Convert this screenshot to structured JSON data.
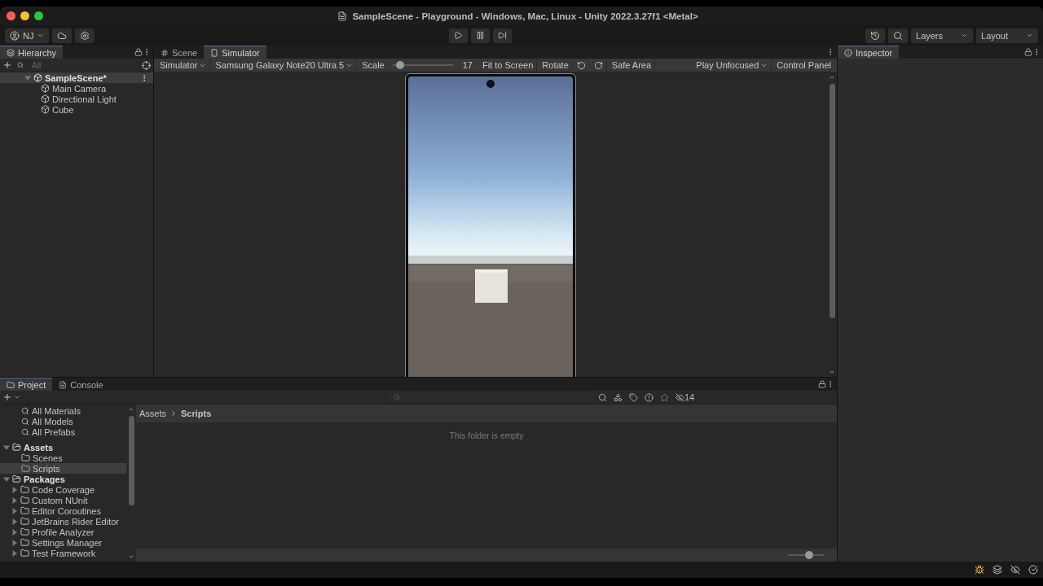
{
  "window": {
    "title": "SampleScene - Playground - Windows, Mac, Linux - Unity 2022.3.27f1 <Metal>"
  },
  "toolbar": {
    "account": "NJ",
    "layers": "Layers",
    "layout": "Layout"
  },
  "hierarchy": {
    "tab": "Hierarchy",
    "search_placeholder": "All",
    "scene": {
      "name": "SampleScene*",
      "expanded": true,
      "children": [
        {
          "name": "Main Camera"
        },
        {
          "name": "Directional Light"
        },
        {
          "name": "Cube"
        }
      ]
    }
  },
  "view_tabs": [
    {
      "label": "Scene",
      "kind": "scene",
      "selected": false
    },
    {
      "label": "Simulator",
      "kind": "simulator",
      "selected": true
    }
  ],
  "simulator_bar": {
    "mode": "Simulator",
    "device": "Samsung Galaxy Note20 Ultra 5",
    "scale_label": "Scale",
    "scale": {
      "level": 0.12
    },
    "scale_reading": "17",
    "fit": "Fit to Screen",
    "rotate": "Rotate",
    "safe_area": "Safe Area",
    "play_mode": "Play Unfocused",
    "control_panel": "Control Panel"
  },
  "simulator_view": {
    "kind": "picture"
  },
  "inspector": {
    "tab": "Inspector"
  },
  "bottom_tabs": [
    {
      "label": "Project",
      "kind": "project",
      "selected": true
    },
    {
      "label": "Console",
      "kind": "console",
      "selected": false
    }
  ],
  "favorites": [
    "All Materials",
    "All Models",
    "All Prefabs"
  ],
  "folders": [
    {
      "name": "Assets",
      "expanded": true,
      "selected": false,
      "children": [
        {
          "name": "Scenes",
          "selected": false
        },
        {
          "name": "Scripts",
          "selected": true
        }
      ]
    },
    {
      "name": "Packages",
      "expanded": true,
      "selected": false,
      "children": [
        {
          "name": "Code Coverage",
          "selected": false,
          "expanded": false
        },
        {
          "name": "Custom NUnit",
          "selected": false,
          "expanded": false
        },
        {
          "name": "Editor Coroutines",
          "selected": false,
          "expanded": false
        },
        {
          "name": "JetBrains Rider Editor",
          "selected": false,
          "expanded": false
        },
        {
          "name": "Profile Analyzer",
          "selected": false,
          "expanded": false
        },
        {
          "name": "Settings Manager",
          "selected": false,
          "expanded": false
        },
        {
          "name": "Test Framework",
          "selected": false,
          "expanded": false
        }
      ]
    }
  ],
  "breadcrumb": [
    "Assets",
    "Scripts"
  ],
  "empty_message": "This folder is empty",
  "hidden_count": "14",
  "icon_size": {
    "level": 0.58
  }
}
